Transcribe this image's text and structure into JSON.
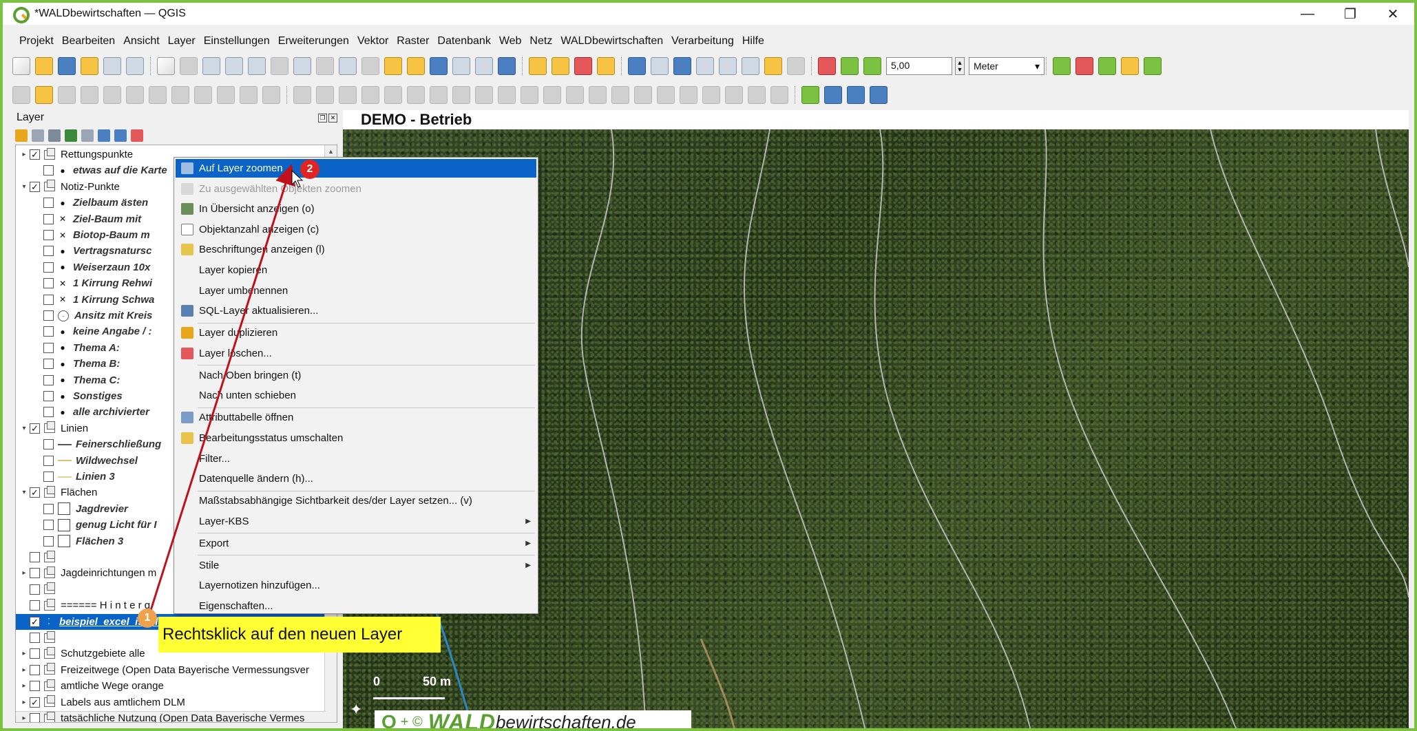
{
  "window": {
    "title": "*WALDbewirtschaften — QGIS",
    "min": "—",
    "max": "❐",
    "close": "✕"
  },
  "menubar": [
    "Projekt",
    "Bearbeiten",
    "Ansicht",
    "Layer",
    "Einstellungen",
    "Erweiterungen",
    "Vektor",
    "Raster",
    "Datenbank",
    "Web",
    "Netz",
    "WALDbewirtschaften",
    "Verarbeitung",
    "Hilfe"
  ],
  "toolbar": {
    "snap_value": "5,00",
    "unit": "Meter"
  },
  "layer_panel": {
    "title": "Layer",
    "rows": [
      {
        "label": "Rettungspunkte",
        "level": 0,
        "expand": "▸",
        "checked": true,
        "kind": "group"
      },
      {
        "label": "etwas auf die Karte",
        "level": 1,
        "checked": false,
        "kind": "dot",
        "italic": true
      },
      {
        "label": "Notiz-Punkte",
        "level": 0,
        "expand": "▾",
        "checked": true,
        "kind": "group"
      },
      {
        "label": "Zielbaum ästen",
        "level": 1,
        "checked": false,
        "kind": "dot",
        "italic": true
      },
      {
        "label": "Ziel-Baum mit",
        "level": 1,
        "checked": false,
        "kind": "x",
        "italic": true
      },
      {
        "label": "Biotop-Baum m",
        "level": 1,
        "checked": false,
        "kind": "x",
        "italic": true
      },
      {
        "label": "Vertragsnatursc",
        "level": 1,
        "checked": false,
        "kind": "dot",
        "italic": true
      },
      {
        "label": "Weiserzaun 10x",
        "level": 1,
        "checked": false,
        "kind": "dot",
        "italic": true
      },
      {
        "label": "1 Kirrung Rehwi",
        "level": 1,
        "checked": false,
        "kind": "x",
        "italic": true
      },
      {
        "label": "1 Kirrung Schwa",
        "level": 1,
        "checked": false,
        "kind": "x",
        "italic": true
      },
      {
        "label": "Ansitz mit Kreis",
        "level": 1,
        "checked": false,
        "kind": "circle",
        "italic": true
      },
      {
        "label": "keine Angabe / :",
        "level": 1,
        "checked": false,
        "kind": "dot",
        "italic": true
      },
      {
        "label": "Thema A:",
        "level": 1,
        "checked": false,
        "kind": "dot",
        "italic": true
      },
      {
        "label": "Thema B:",
        "level": 1,
        "checked": false,
        "kind": "dot",
        "italic": true
      },
      {
        "label": "Thema C:",
        "level": 1,
        "checked": false,
        "kind": "dot",
        "italic": true
      },
      {
        "label": "Sonstiges",
        "level": 1,
        "checked": false,
        "kind": "dot",
        "italic": true
      },
      {
        "label": "alle archivierter",
        "level": 1,
        "checked": false,
        "kind": "dot",
        "italic": true
      },
      {
        "label": "Linien",
        "level": 0,
        "expand": "▾",
        "checked": true,
        "kind": "group"
      },
      {
        "label": "Feinerschließung",
        "level": 1,
        "checked": false,
        "kind": "line",
        "italic": true
      },
      {
        "label": "Wildwechsel",
        "level": 1,
        "checked": false,
        "kind": "line",
        "italic": true
      },
      {
        "label": "Linien 3",
        "level": 1,
        "checked": false,
        "kind": "line",
        "italic": true
      },
      {
        "label": "Flächen",
        "level": 0,
        "expand": "▾",
        "checked": true,
        "kind": "group"
      },
      {
        "label": "Jagdrevier",
        "level": 1,
        "checked": false,
        "kind": "square",
        "italic": true
      },
      {
        "label": "genug Licht für I",
        "level": 1,
        "checked": false,
        "kind": "square",
        "italic": true
      },
      {
        "label": "Flächen 3",
        "level": 1,
        "checked": false,
        "kind": "square",
        "italic": true
      },
      {
        "label": "",
        "level": 0,
        "checked": false,
        "kind": "group"
      },
      {
        "label": "Jagdeinrichtungen m",
        "level": 0,
        "expand": "▸",
        "checked": false,
        "kind": "group"
      },
      {
        "label": "",
        "level": 0,
        "checked": false,
        "kind": "group"
      },
      {
        "label": "====== H i n t e r g",
        "level": 0,
        "checked": false,
        "kind": "group"
      },
      {
        "label": "beispiel_excel_iscel_excel",
        "level": 0,
        "checked": true,
        "kind": "point",
        "selected": true
      },
      {
        "label": "",
        "level": 0,
        "checked": false,
        "kind": "group"
      },
      {
        "label": "Schutzgebiete alle",
        "level": 0,
        "expand": "▸",
        "checked": false,
        "kind": "group"
      },
      {
        "label": "Freizeitwege (Open Data Bayerische Vermessungsver",
        "level": 0,
        "expand": "▸",
        "checked": false,
        "kind": "group"
      },
      {
        "label": "amtliche Wege orange",
        "level": 0,
        "expand": "▸",
        "checked": false,
        "kind": "group"
      },
      {
        "label": "Labels aus amtlichem DLM",
        "level": 0,
        "expand": "▸",
        "checked": true,
        "kind": "group"
      },
      {
        "label": "tatsächliche Nutzung  (Open Data Bayerische Vermes",
        "level": 0,
        "expand": "▸",
        "checked": false,
        "kind": "group"
      }
    ]
  },
  "map": {
    "title": "DEMO - Betrieb",
    "scale_0": "0",
    "scale_50": "50 m",
    "brand_q": "Q",
    "brand_plus": "+ ©",
    "brand_wald": "WALD",
    "brand_rest": "bewirtschaften.de"
  },
  "context_menu": {
    "items": [
      {
        "label": "Auf Layer zoomen",
        "state": "highlight",
        "icon": "zoom-layer-icon"
      },
      {
        "label": "Zu ausgewählten Objekten zoomen",
        "state": "disabled",
        "icon": "zoom-selection-icon"
      },
      {
        "label": "In Übersicht anzeigen (o)",
        "state": "normal",
        "icon": "overview-icon"
      },
      {
        "label": "Objektanzahl anzeigen (c)",
        "state": "check",
        "icon": "checkbox-icon"
      },
      {
        "label": "Beschriftungen anzeigen (l)",
        "state": "normal",
        "icon": "labels-icon"
      },
      {
        "label": "Layer kopieren",
        "state": "normal",
        "icon": ""
      },
      {
        "label": "Layer umbenennen",
        "state": "normal",
        "icon": ""
      },
      {
        "label": "SQL-Layer aktualisieren...",
        "state": "normal",
        "icon": "database-icon",
        "sep_after": true
      },
      {
        "label": "Layer duplizieren",
        "state": "normal",
        "icon": "duplicate-icon"
      },
      {
        "label": "Layer löschen...",
        "state": "normal",
        "icon": "delete-layer-icon",
        "sep_after": true
      },
      {
        "label": "Nach Oben bringen (t)",
        "state": "normal",
        "icon": ""
      },
      {
        "label": "Nach unten schieben",
        "state": "normal",
        "icon": "",
        "sep_after": true
      },
      {
        "label": "Attributtabelle öffnen",
        "state": "normal",
        "icon": "table-icon"
      },
      {
        "label": "Bearbeitungsstatus umschalten",
        "state": "normal",
        "icon": "pencil-icon"
      },
      {
        "label": "Filter...",
        "state": "normal",
        "icon": ""
      },
      {
        "label": "Datenquelle ändern (h)...",
        "state": "normal",
        "icon": "",
        "sep_after": true
      },
      {
        "label": "Maßstabsabhängige Sichtbarkeit des/der Layer setzen... (v)",
        "state": "normal",
        "icon": ""
      },
      {
        "label": "Layer-KBS",
        "state": "submenu",
        "icon": "",
        "sep_after": true
      },
      {
        "label": "Export",
        "state": "submenu",
        "icon": "",
        "sep_after": true
      },
      {
        "label": "Stile",
        "state": "submenu",
        "icon": ""
      },
      {
        "label": "Layernotizen hinzufügen...",
        "state": "normal",
        "icon": ""
      },
      {
        "label": "Eigenschaften...",
        "state": "normal",
        "icon": ""
      }
    ]
  },
  "annotations": {
    "badge1": "1",
    "badge2": "2",
    "callout": "Rechtsklick auf den neuen Layer"
  },
  "colors": {
    "accent": "#0a64c8",
    "brand_green": "#5a9f2f",
    "frame": "#7cc242",
    "callout": "#ffff33",
    "badge1": "#f0a24a",
    "badge2": "#e02323",
    "arrow": "#c0101a"
  }
}
